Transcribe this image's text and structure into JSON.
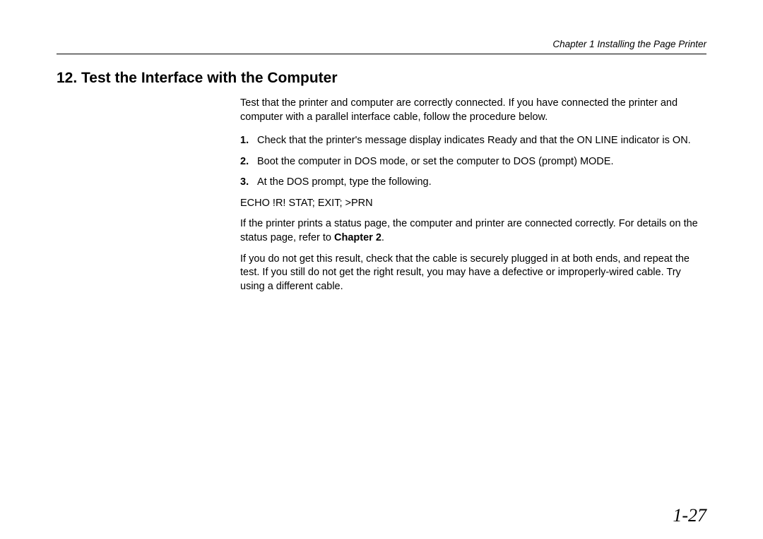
{
  "header": {
    "chapter_text": "Chapter 1 Installing the Page Printer"
  },
  "heading": "12. Test the Interface with the Computer",
  "body": {
    "intro": "Test that the printer and computer are correctly connected. If you have connected the printer and computer with a parallel interface cable, follow the procedure below.",
    "steps": [
      {
        "num": "1.",
        "part1": "Check that the printer's message display indicates ",
        "code": "Ready",
        "part2": " and that the ON LINE indicator is ON."
      },
      {
        "num": "2.",
        "text": "Boot the computer in DOS mode, or set the computer to DOS (prompt) MODE."
      },
      {
        "num": "3.",
        "text": "At the DOS prompt, type the following."
      }
    ],
    "command": "ECHO !R! STAT; EXIT; >PRN",
    "para1_a": "If the printer prints a status page, the computer and printer are connected correctly. For details on the status page, refer to ",
    "para1_bold": "Chapter 2",
    "para1_b": ".",
    "para2": "If you do not get this result, check that the cable is securely plugged in at both ends, and repeat the test. If you still do not get the right result, you may have a defective or improperly-wired cable. Try using a different cable."
  },
  "page_number": "1-27"
}
